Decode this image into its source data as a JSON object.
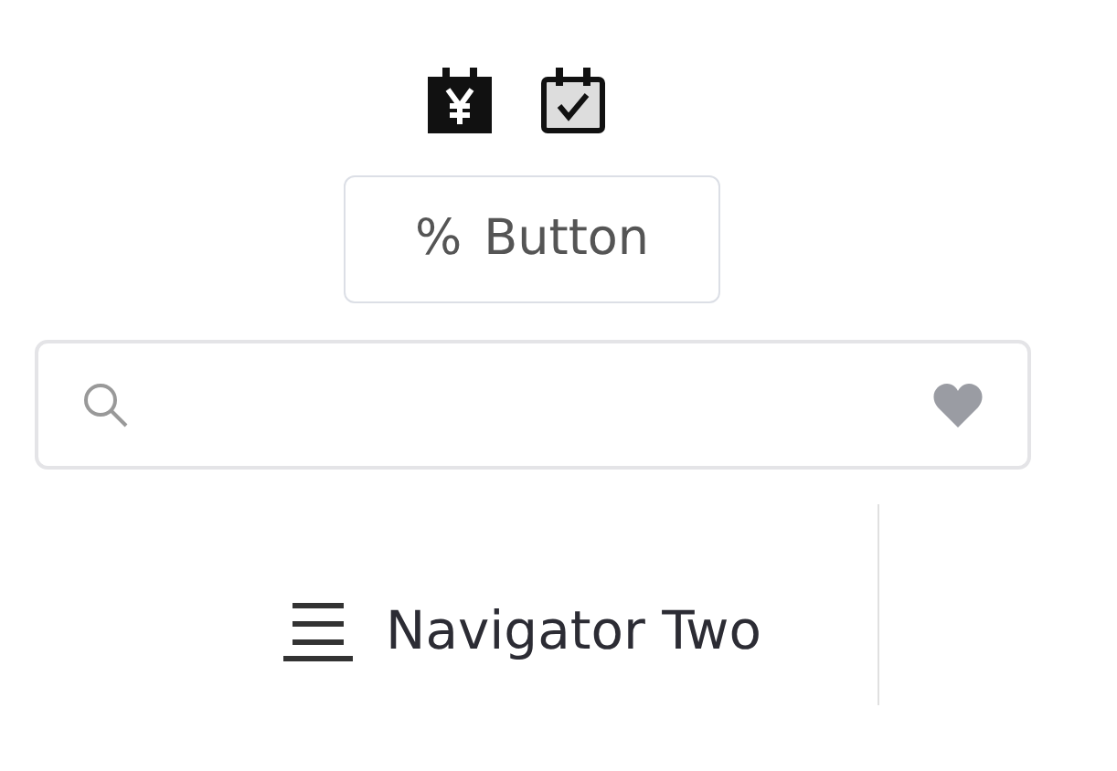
{
  "button": {
    "icon": "%",
    "label": "Button"
  },
  "menu_item": {
    "label": "Navigator Two"
  }
}
